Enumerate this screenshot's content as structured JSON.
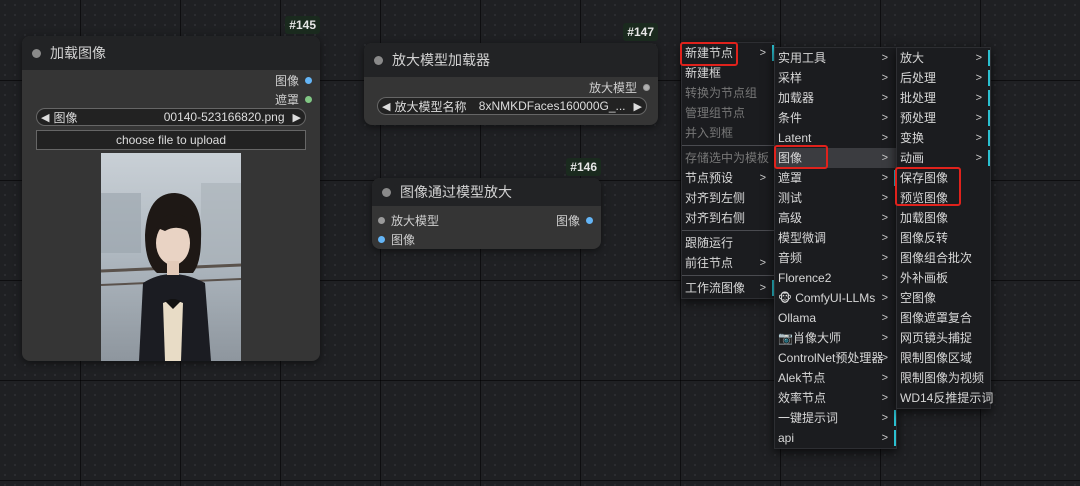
{
  "nodes": {
    "load_image": {
      "id": "#145",
      "title": "加载图像",
      "outputs": [
        "图像",
        "遮罩"
      ],
      "widget_label": "图像",
      "widget_value": "00140-523166820.png",
      "upload_label": "choose file to upload"
    },
    "upscale_loader": {
      "id": "#147",
      "title": "放大模型加载器",
      "output": "放大模型",
      "widget_label": "放大模型名称",
      "widget_value": "8xNMKDFaces160000G_..."
    },
    "image_upscale": {
      "id": "#146",
      "title": "图像通过模型放大",
      "inputs": [
        "放大模型",
        "图像"
      ],
      "output": "图像"
    }
  },
  "menus": {
    "context": [
      {
        "label": "新建节点",
        "submenu": true
      },
      {
        "label": "新建框"
      },
      {
        "label": "转换为节点组",
        "disabled": true
      },
      {
        "label": "管理组节点",
        "disabled": true
      },
      {
        "label": "并入到框",
        "disabled": true
      },
      {
        "label": "存储选中为模板",
        "disabled": true
      },
      {
        "label": "节点预设",
        "submenu": true
      },
      {
        "label": "对齐到左侧"
      },
      {
        "label": "对齐到右侧"
      },
      {
        "label": "跟随运行"
      },
      {
        "label": "前往节点",
        "submenu": true
      },
      {
        "label": "工作流图像",
        "submenu": true
      }
    ],
    "categories": [
      {
        "label": "实用工具"
      },
      {
        "label": "采样"
      },
      {
        "label": "加载器"
      },
      {
        "label": "条件"
      },
      {
        "label": "Latent"
      },
      {
        "label": "图像"
      },
      {
        "label": "遮罩"
      },
      {
        "label": "测试"
      },
      {
        "label": "高级"
      },
      {
        "label": "模型微调"
      },
      {
        "label": "音频"
      },
      {
        "label": "Florence2"
      },
      {
        "label": "🐵 ComfyUI-LLMs"
      },
      {
        "label": "Ollama"
      },
      {
        "label": "📷肖像大师"
      },
      {
        "label": "ControlNet预处理器"
      },
      {
        "label": "Alek节点"
      },
      {
        "label": "效率节点"
      },
      {
        "label": "一键提示词"
      },
      {
        "label": "api"
      }
    ],
    "image_sub": [
      {
        "label": "放大",
        "submenu": true
      },
      {
        "label": "后处理",
        "submenu": true
      },
      {
        "label": "批处理",
        "submenu": true
      },
      {
        "label": "预处理",
        "submenu": true
      },
      {
        "label": "变换",
        "submenu": true
      },
      {
        "label": "动画",
        "submenu": true
      },
      {
        "label": "保存图像"
      },
      {
        "label": "预览图像"
      },
      {
        "label": "加载图像"
      },
      {
        "label": "图像反转"
      },
      {
        "label": "图像组合批次"
      },
      {
        "label": "外补画板"
      },
      {
        "label": "空图像"
      },
      {
        "label": "图像遮罩复合"
      },
      {
        "label": "网页镜头捕捉"
      },
      {
        "label": "限制图像区域"
      },
      {
        "label": "限制图像为视频"
      },
      {
        "label": "WD14反推提示词"
      }
    ]
  },
  "colors": {
    "accent_bar": "#2bc0d0",
    "highlight": "#e0221c",
    "image_socket": "#64b5f6",
    "mask_socket": "#81c784",
    "upscale_model_socket": "#b0b0b0"
  }
}
